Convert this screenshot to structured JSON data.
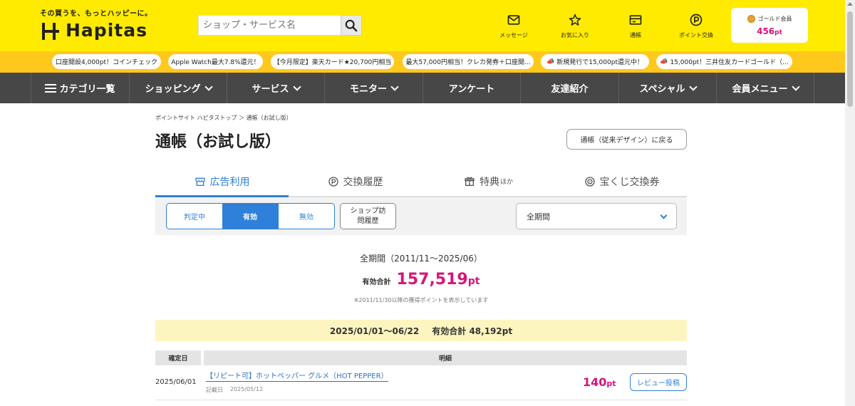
{
  "header": {
    "tagline": "その買うを、もっとハッピーに。",
    "logo_text": "Hapitas",
    "search_placeholder": "ショップ・サービス名",
    "nav": [
      {
        "label": "メッセージ",
        "icon": "mail-icon"
      },
      {
        "label": "お気に入り",
        "icon": "star-icon"
      },
      {
        "label": "通帳",
        "icon": "passbook-icon"
      },
      {
        "label": "ポイント交換",
        "icon": "point-exchange-icon"
      }
    ],
    "member": {
      "rank": "ゴールド会員",
      "points": "456",
      "unit": "pt"
    }
  },
  "campaigns": [
    "口座開設4,000pt！コインチェック",
    "Apple Watch最大7.8%還元！",
    "【今月限定】楽天カード★20,700円相当",
    "最大57,000円相当！クレカ発券＋口座開...",
    "新規発行で15,000pt還元中！",
    "15,000pt！三井住友カードゴールド（..."
  ],
  "main_nav": [
    {
      "label": "カテゴリ一覧",
      "dropdown": false
    },
    {
      "label": "ショッピング",
      "dropdown": true
    },
    {
      "label": "サービス",
      "dropdown": true
    },
    {
      "label": "モニター",
      "dropdown": true
    },
    {
      "label": "アンケート",
      "dropdown": false
    },
    {
      "label": "友達紹介",
      "dropdown": false
    },
    {
      "label": "スペシャル",
      "dropdown": true
    },
    {
      "label": "会員メニュー",
      "dropdown": true
    }
  ],
  "breadcrumb": "ポイントサイト ハピタストップ ＞ 通帳（お試し版）",
  "page_title": "通帳（お試し版）",
  "back_button": "通帳（従来デザイン）に戻る",
  "tabs": [
    {
      "label": "広告利用",
      "suffix": "",
      "active": true
    },
    {
      "label": "交換履歴",
      "suffix": "",
      "active": false
    },
    {
      "label": "特典",
      "suffix": "ほか",
      "active": false
    },
    {
      "label": "宝くじ交換券",
      "suffix": "",
      "active": false
    }
  ],
  "filters": {
    "segments": [
      "判定中",
      "有効",
      "無効"
    ],
    "active_segment": "有効",
    "shop_history_button": "ショップ訪問履歴",
    "period_selected": "全期間"
  },
  "summary": {
    "period": "全期間（2011/11～2025/06）",
    "total_label": "有効合計",
    "total_value": "157,519",
    "total_unit": "pt",
    "note": "※2011/11/30以降の獲得ポイントを表示しています"
  },
  "year_band": {
    "range": "2025/01/01～06/22",
    "total": "有効合計 48,192pt"
  },
  "table": {
    "headers": [
      "確定日",
      "明細"
    ],
    "rows": [
      {
        "date": "2025/06/01",
        "title": "【リピート可】ホットペッパー グルメ（HOT PEPPER）",
        "recorded_label": "記載日",
        "recorded_date": "2025/05/12",
        "points": "140",
        "unit": "pt",
        "action": "レビュー投稿"
      }
    ]
  },
  "colors": {
    "header_yellow": "#ffeb00",
    "campaign_yellow": "#ffc81c",
    "nav_gray": "#474747",
    "accent_blue": "#2f80d8",
    "points_pink": "#d6157a"
  }
}
